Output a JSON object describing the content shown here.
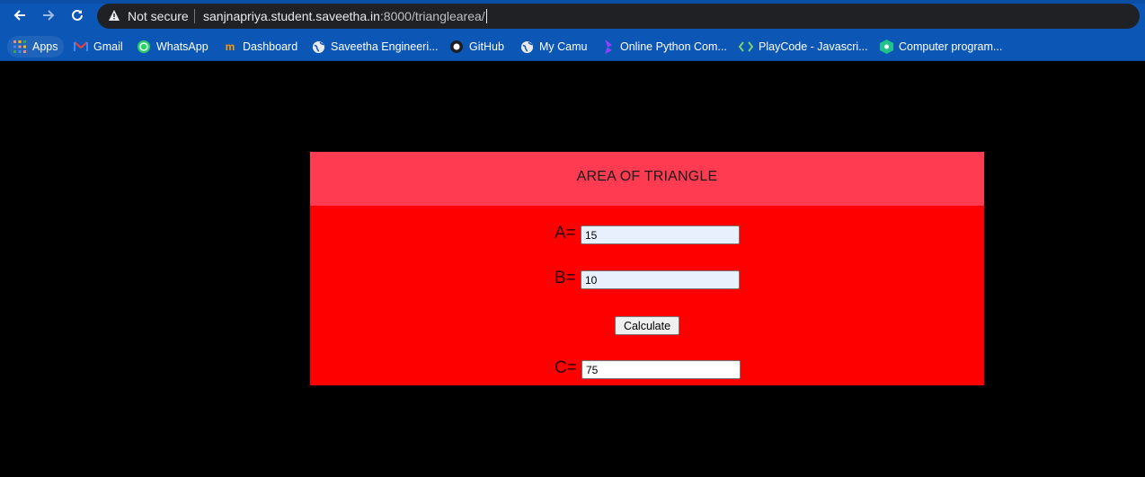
{
  "browser": {
    "nav": {
      "back_icon": "arrow-left-icon",
      "forward_icon": "arrow-right-icon",
      "reload_icon": "reload-icon"
    },
    "security_label": "Not secure",
    "url_host": "sanjnapriya.student.saveetha.in",
    "url_path": ":8000/trianglearea/",
    "bookmarks": [
      {
        "label": "Apps",
        "icon": "apps-grid-icon"
      },
      {
        "label": "Gmail",
        "icon": "gmail-icon"
      },
      {
        "label": "WhatsApp",
        "icon": "whatsapp-icon"
      },
      {
        "label": "Dashboard",
        "icon": "dashboard-icon"
      },
      {
        "label": "Saveetha Engineeri...",
        "icon": "globe-icon"
      },
      {
        "label": "GitHub",
        "icon": "github-icon"
      },
      {
        "label": "My Camu",
        "icon": "globe-icon"
      },
      {
        "label": "Online Python Com...",
        "icon": "python-compiler-icon"
      },
      {
        "label": "PlayCode - Javascri...",
        "icon": "playcode-icon"
      },
      {
        "label": "Computer program...",
        "icon": "programiz-icon"
      }
    ]
  },
  "page": {
    "title": "AREA OF TRIANGLE",
    "a_label": "A=",
    "a_value": "15",
    "b_label": "B=",
    "b_value": "10",
    "calculate_label": "Calculate",
    "c_label": "C=",
    "c_value": "75"
  },
  "colors": {
    "card_background": "#ff0000",
    "header_background": "#ff3b52",
    "page_background": "#000000",
    "browser_chrome": "#0c57b5"
  }
}
